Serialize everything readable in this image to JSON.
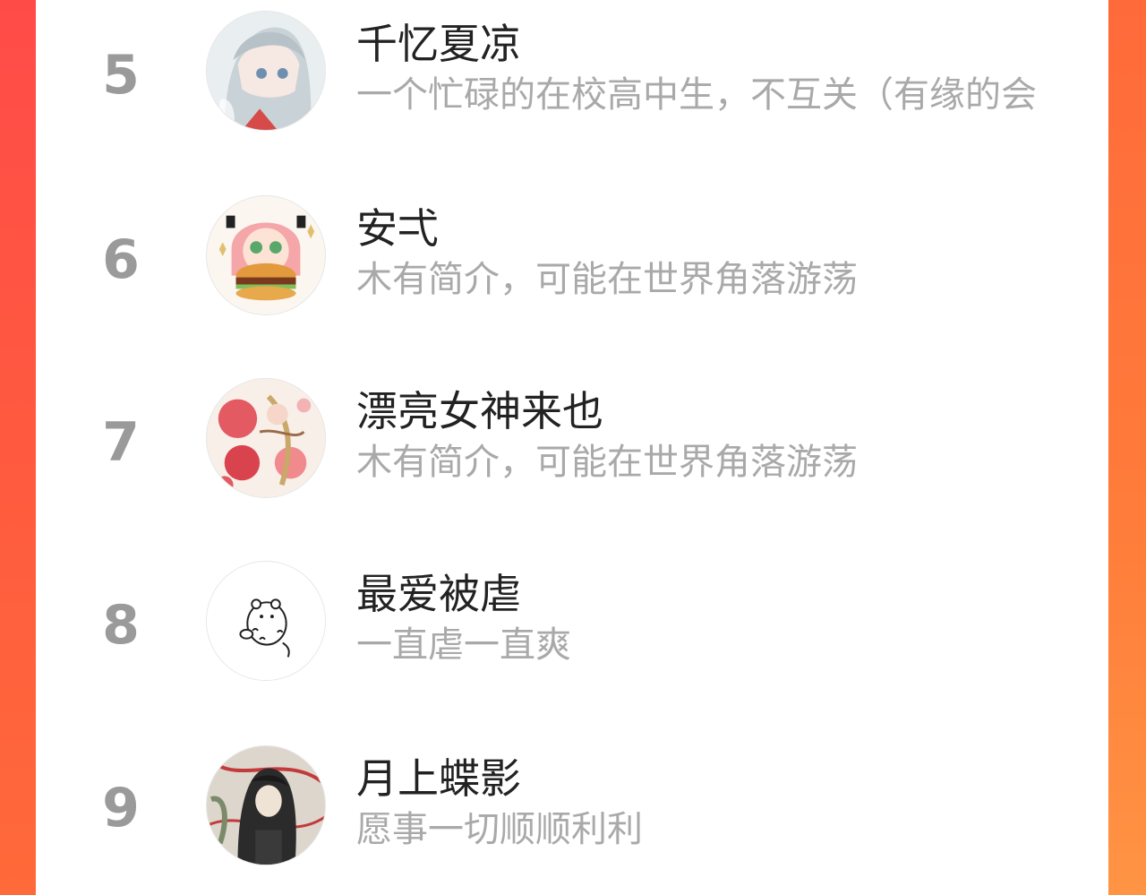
{
  "ranking": {
    "items": [
      {
        "rank": "5",
        "name": "千忆夏凉",
        "bio": "一个忙碌的在校高中生，不互关（有缘的会"
      },
      {
        "rank": "6",
        "name": "安弌",
        "bio": "木有简介，可能在世界角落游荡"
      },
      {
        "rank": "7",
        "name": "漂亮女神来也",
        "bio": "木有简介，可能在世界角落游荡"
      },
      {
        "rank": "8",
        "name": "最爱被虐",
        "bio": "一直虐一直爽"
      },
      {
        "rank": "9",
        "name": "月上蝶影",
        "bio": "愿事一切顺顺利利"
      }
    ]
  },
  "colors": {
    "accent_left": "#ff4a4a",
    "accent_right": "#ff8a40",
    "rank_gray": "#9a9a9a",
    "name_dark": "#222222",
    "bio_gray": "#a9a9a9"
  }
}
